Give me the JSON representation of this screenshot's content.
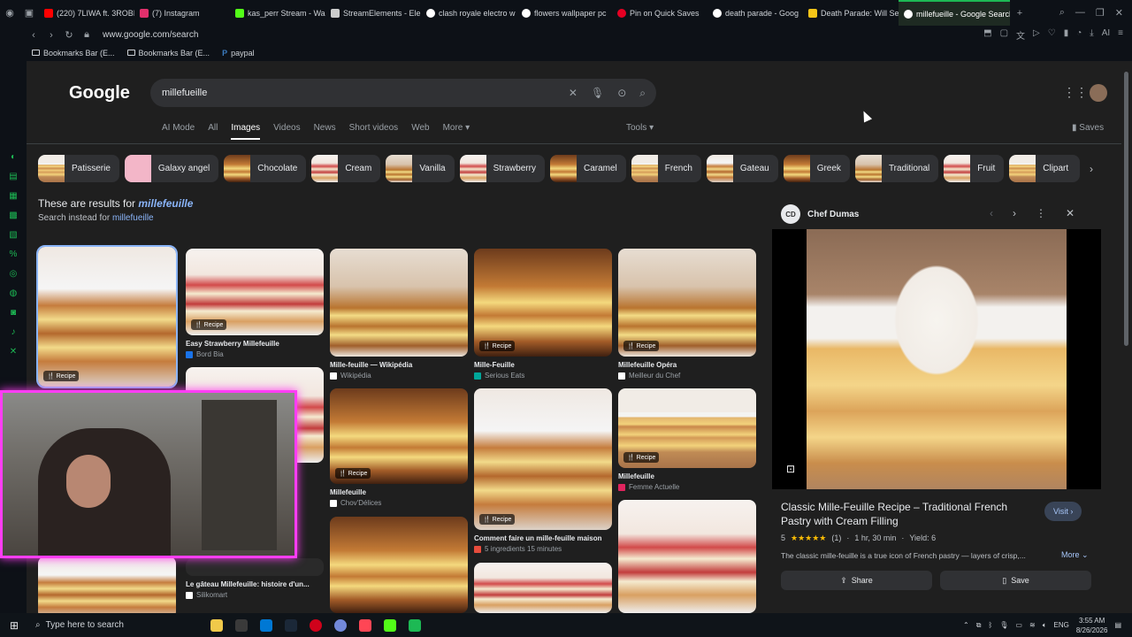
{
  "browser": {
    "tabs": [
      {
        "label": "(220) 7LIWA ft. 3ROBI",
        "color": "#ff0000"
      },
      {
        "label": "(7) Instagram",
        "color": "#e1306c"
      },
      {
        "label": "kas_perr Stream - Wa",
        "color": "#53fc18"
      },
      {
        "label": "StreamElements - Ele",
        "color": "#cccccc"
      },
      {
        "label": "clash royale electro w",
        "color": "#ffffff"
      },
      {
        "label": "flowers wallpaper pc",
        "color": "#ffffff"
      },
      {
        "label": "Pin on Quick Saves",
        "color": "#e60023"
      },
      {
        "label": "death parade - Goog",
        "color": "#ffffff"
      },
      {
        "label": "Death Parade: Will Se",
        "color": "#f5c518"
      },
      {
        "label": "millefueille - Google Search",
        "color": "#ffffff",
        "active": true
      }
    ],
    "new_tab": "+",
    "url": "www.google.com/search",
    "bookmarks": [
      {
        "label": "Bookmarks Bar (E..."
      },
      {
        "label": "Bookmarks Bar (E..."
      },
      {
        "label": "paypal"
      }
    ]
  },
  "google": {
    "logo": "Google",
    "query": "millefueille",
    "nav_tabs": [
      "AI Mode",
      "All",
      "Images",
      "Videos",
      "News",
      "Short videos",
      "Web",
      "More ▾"
    ],
    "active_tab": "Images",
    "tools": "Tools ▾",
    "saves": "Saves",
    "chips": [
      {
        "label": "Patisserie"
      },
      {
        "label": "Galaxy angel"
      },
      {
        "label": "Chocolate"
      },
      {
        "label": "Cream"
      },
      {
        "label": "Vanilla"
      },
      {
        "label": "Strawberry"
      },
      {
        "label": "Caramel"
      },
      {
        "label": "French"
      },
      {
        "label": "Gateau"
      },
      {
        "label": "Greek"
      },
      {
        "label": "Traditional"
      },
      {
        "label": "Fruit"
      },
      {
        "label": "Clipart"
      }
    ],
    "results_prefix": "These are results for ",
    "results_query": "millefeuille",
    "instead_prefix": "Search instead for ",
    "instead_query": "millefueille",
    "recipe_badge": "🍴 Recipe",
    "cards": [
      {
        "title": "Easy Strawberry Millefeuille",
        "source": "Bord Bia",
        "src_color": "#1a73e8"
      },
      {
        "title": "Mille-feuille — Wikipédia",
        "source": "Wikipédia",
        "src_color": "#ffffff"
      },
      {
        "title": "Mille-Feuille",
        "source": "Serious Eats",
        "src_color": "#00a699"
      },
      {
        "title": "Millefeuille Opéra",
        "source": "Meilleur du Chef",
        "src_color": "#ffffff"
      },
      {
        "title": "Millefeuille",
        "source": "Chov'Délices",
        "src_color": "#ffffff"
      },
      {
        "title": "Comment faire un mille-feuille maison",
        "source": "5 ingredients 15 minutes",
        "src_color": "#e74c3c"
      },
      {
        "title": "Millefeuille",
        "source": "Femme Actuelle",
        "src_color": "#e0245e"
      },
      {
        "title": "Le gâteau Millefeuille: histoire d'un...",
        "source": "Silikomart",
        "src_color": "#ffffff"
      }
    ]
  },
  "panel": {
    "source": "Chef Dumas",
    "source_logo": "CD",
    "title": "Classic Mille-Feuille Recipe – Traditional French Pastry with Cream Filling",
    "visit": "Visit ›",
    "rating": "5",
    "stars": "★★★★★",
    "reviews": "(1)",
    "time": "1 hr, 30 min",
    "yield": "Yield: 6",
    "description": "The classic mille-feuille is a true icon of French pastry — layers of crisp,...",
    "more": "More ⌄",
    "share": "Share",
    "save": "Save"
  },
  "taskbar": {
    "search_placeholder": "Type here to search",
    "lang": "ENG",
    "time": "3:55 AM",
    "date": "8/26/2026"
  }
}
